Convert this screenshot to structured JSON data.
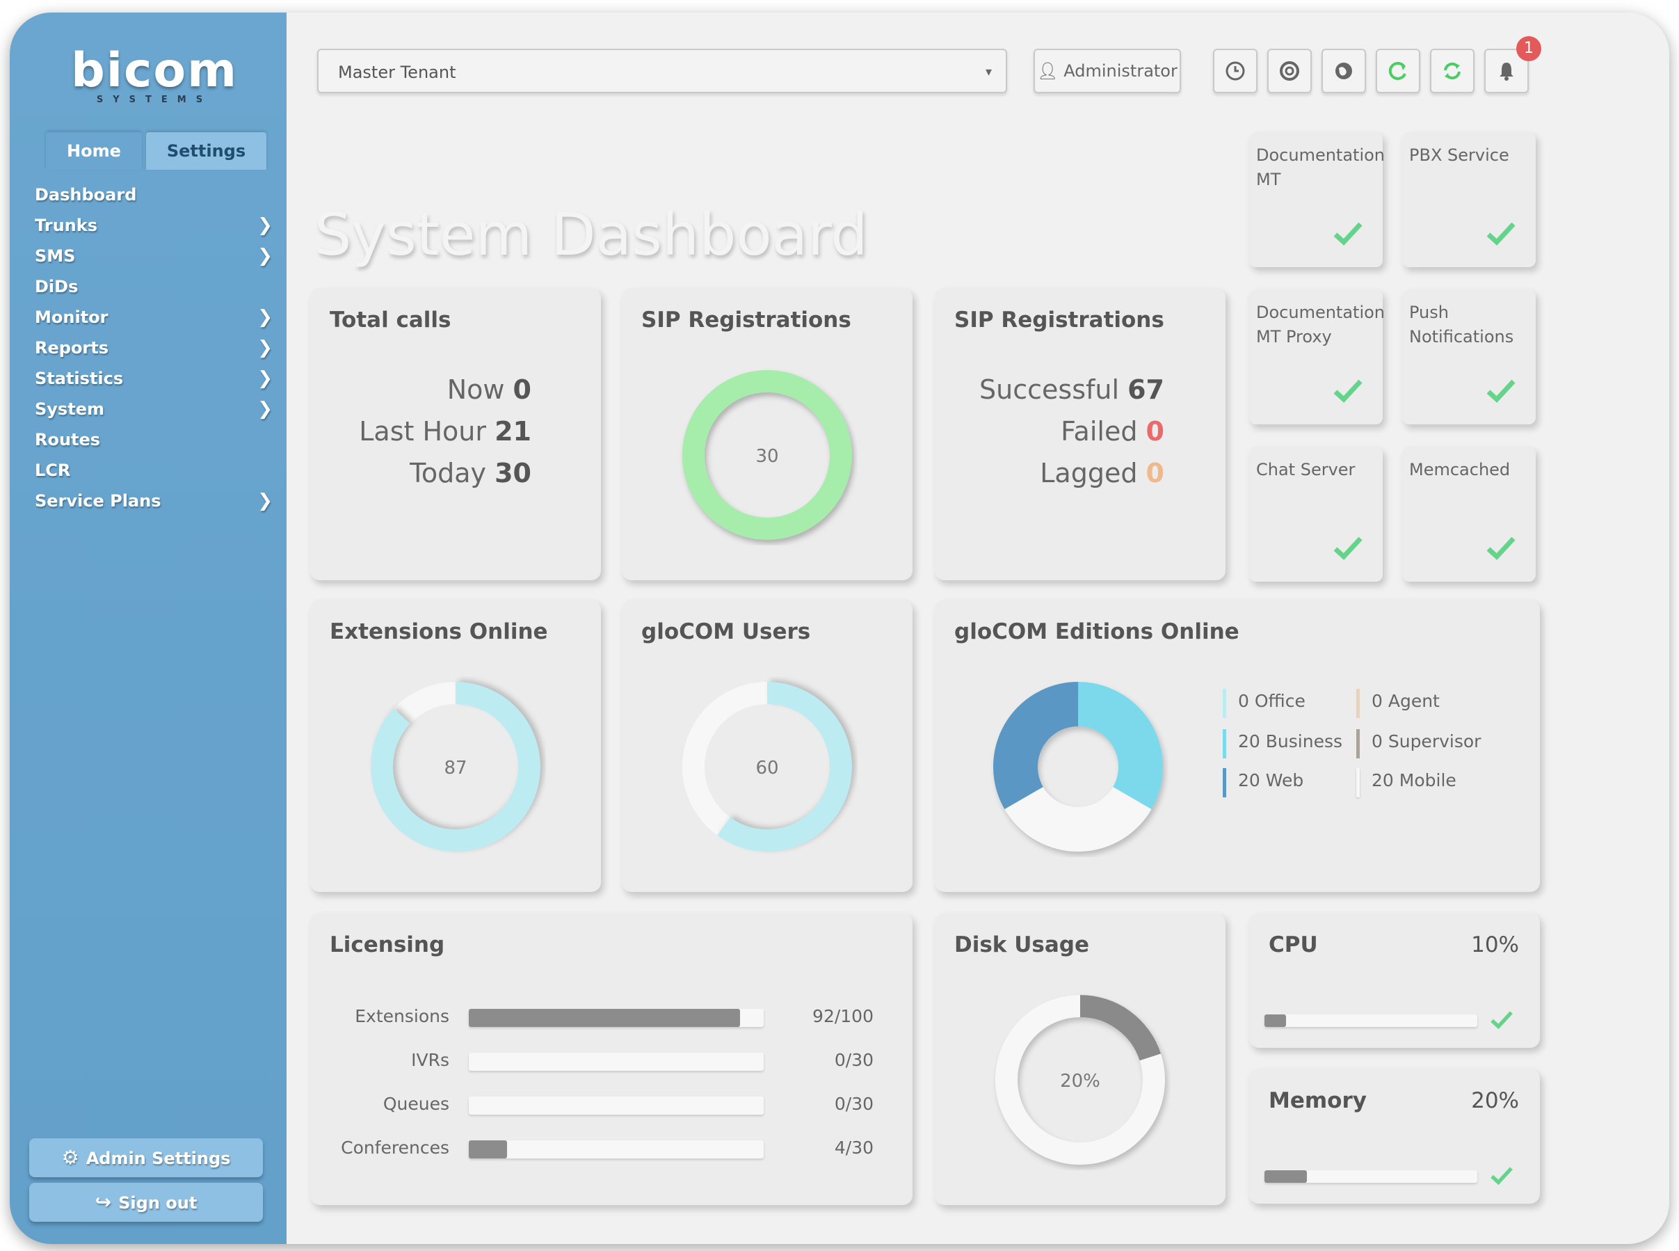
{
  "app": {
    "logo_text": "bicom",
    "logo_sub": "SYSTEMS"
  },
  "sidebar": {
    "tabs": [
      {
        "label": "Home"
      },
      {
        "label": "Settings"
      }
    ],
    "items": [
      {
        "label": "Dashboard",
        "has_children": false
      },
      {
        "label": "Trunks",
        "has_children": true
      },
      {
        "label": "SMS",
        "has_children": true
      },
      {
        "label": "DiDs",
        "has_children": false
      },
      {
        "label": "Monitor",
        "has_children": true
      },
      {
        "label": "Reports",
        "has_children": true
      },
      {
        "label": "Statistics",
        "has_children": true
      },
      {
        "label": "System",
        "has_children": true
      },
      {
        "label": "Routes",
        "has_children": false
      },
      {
        "label": "LCR",
        "has_children": false
      },
      {
        "label": "Service Plans",
        "has_children": true
      }
    ],
    "admin_settings_label": "Admin Settings",
    "sign_out_label": "Sign out"
  },
  "topbar": {
    "tenant_value": "Master Tenant",
    "admin_label": "Administrator",
    "notification_count": "1",
    "icons": [
      "clock-icon",
      "lifebuoy-icon",
      "globe-icon",
      "reload-icon",
      "sync-icon",
      "bell-icon"
    ]
  },
  "page_title": "System Dashboard",
  "services": [
    {
      "name": "Documentation MT",
      "status": "ok"
    },
    {
      "name": "PBX Service",
      "status": "ok"
    },
    {
      "name": "Documentation MT Proxy",
      "status": "ok"
    },
    {
      "name": "Push Notifications",
      "status": "ok"
    },
    {
      "name": "Chat Server",
      "status": "ok"
    },
    {
      "name": "Memcached",
      "status": "ok"
    }
  ],
  "total_calls": {
    "title": "Total calls",
    "now_label": "Now",
    "now_value": "0",
    "last_hour_label": "Last Hour",
    "last_hour_value": "21",
    "today_label": "Today",
    "today_value": "30"
  },
  "sip_ring": {
    "title": "SIP Registrations",
    "value": "30",
    "color": "#a6ecab"
  },
  "sip_stats": {
    "title": "SIP Registrations",
    "successful_label": "Successful",
    "successful_value": "67",
    "failed_label": "Failed",
    "failed_value": "0",
    "lagged_label": "Lagged",
    "lagged_value": "0",
    "failed_color": "#e86a6a",
    "lagged_color": "#f0b98b"
  },
  "extensions_online": {
    "title": "Extensions Online",
    "value": "87",
    "fraction": 0.87,
    "color": "#bcebf1"
  },
  "glocom_users": {
    "title": "gloCOM Users",
    "value": "60",
    "fraction": 0.6,
    "color": "#bcebf1"
  },
  "glocom_editions": {
    "title": "gloCOM Editions Online",
    "legend": [
      {
        "label": "0 Office",
        "color": "#bcebf1"
      },
      {
        "label": "20 Business",
        "color": "#7cd9ec"
      },
      {
        "label": "20 Web",
        "color": "#5a97c4"
      },
      {
        "label": "0 Agent",
        "color": "#e6d4c0"
      },
      {
        "label": "0 Supervisor",
        "color": "#a9a39a"
      },
      {
        "label": "20 Mobile",
        "color": "#f7f7f7"
      }
    ]
  },
  "licensing": {
    "title": "Licensing",
    "rows": [
      {
        "label": "Extensions",
        "value": "92/100",
        "fraction": 0.92
      },
      {
        "label": "IVRs",
        "value": "0/30",
        "fraction": 0.0
      },
      {
        "label": "Queues",
        "value": "0/30",
        "fraction": 0.0
      },
      {
        "label": "Conferences",
        "value": "4/30",
        "fraction": 0.13
      }
    ]
  },
  "disk_usage": {
    "title": "Disk Usage",
    "value": "20%",
    "fraction": 0.2
  },
  "cpu": {
    "title": "CPU",
    "value": "10%",
    "fraction": 0.1
  },
  "memory": {
    "title": "Memory",
    "value": "20%",
    "fraction": 0.2
  },
  "colors": {
    "sidebar": "#6aa6cf",
    "ok_check": "#63d48a",
    "refresh_green": "#4ccc64"
  }
}
